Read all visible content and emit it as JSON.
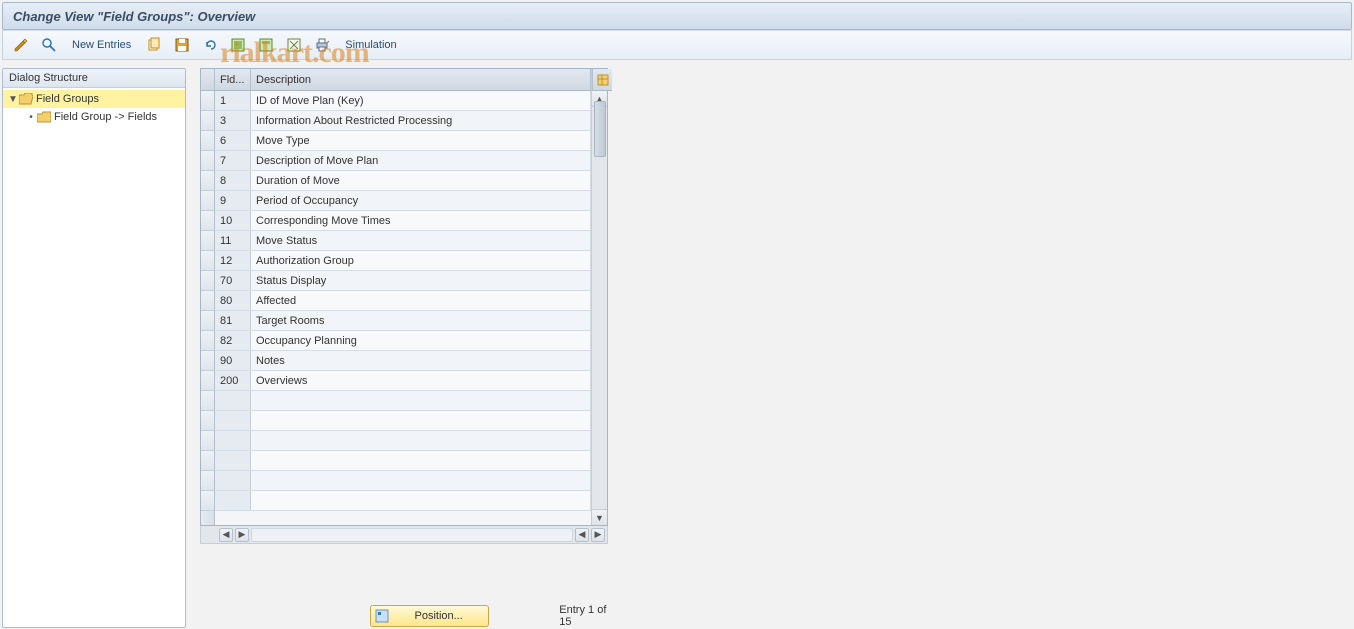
{
  "title": "Change View \"Field Groups\": Overview",
  "watermark": "rialkart.com",
  "toolbar": {
    "new_entries": "New Entries",
    "simulation": "Simulation"
  },
  "tree": {
    "header": "Dialog Structure",
    "nodes": [
      {
        "label": "Field Groups",
        "selected": true,
        "expanded": true,
        "open_folder": true
      },
      {
        "label": "Field Group -> Fields",
        "selected": false,
        "child": true
      }
    ]
  },
  "table": {
    "columns": {
      "fld": "Fld...",
      "desc": "Description"
    },
    "rows": [
      {
        "fld": "1",
        "desc": "ID of Move Plan (Key)"
      },
      {
        "fld": "3",
        "desc": "Information About Restricted Processing"
      },
      {
        "fld": "6",
        "desc": "Move Type"
      },
      {
        "fld": "7",
        "desc": "Description of Move Plan"
      },
      {
        "fld": "8",
        "desc": "Duration of Move"
      },
      {
        "fld": "9",
        "desc": "Period of Occupancy"
      },
      {
        "fld": "10",
        "desc": "Corresponding Move Times"
      },
      {
        "fld": "11",
        "desc": "Move Status"
      },
      {
        "fld": "12",
        "desc": "Authorization Group"
      },
      {
        "fld": "70",
        "desc": "Status Display"
      },
      {
        "fld": "80",
        "desc": "Affected"
      },
      {
        "fld": "81",
        "desc": "Target Rooms"
      },
      {
        "fld": "82",
        "desc": "Occupancy Planning"
      },
      {
        "fld": "90",
        "desc": "Notes"
      },
      {
        "fld": "200",
        "desc": "Overviews"
      }
    ],
    "empty_rows": 6
  },
  "footer": {
    "position_label": "Position...",
    "entry_text": "Entry 1 of 15"
  }
}
